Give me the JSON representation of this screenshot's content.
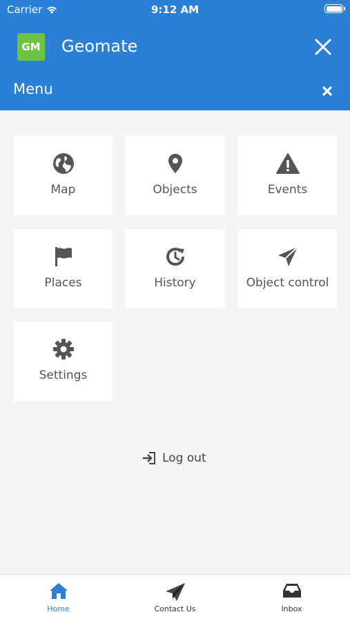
{
  "status_bar": {
    "carrier": "Carrier",
    "time": "9:12 AM"
  },
  "header": {
    "logo_text": "GM",
    "app_title": "Geomate",
    "menu_title": "Menu"
  },
  "menu_items": [
    {
      "label": "Map",
      "icon": "globe-icon"
    },
    {
      "label": "Objects",
      "icon": "map-pin-icon"
    },
    {
      "label": "Events",
      "icon": "warning-icon"
    },
    {
      "label": "Places",
      "icon": "flag-icon"
    },
    {
      "label": "History",
      "icon": "history-icon"
    },
    {
      "label": "Object control",
      "icon": "send-icon"
    },
    {
      "label": "Settings",
      "icon": "gear-icon"
    }
  ],
  "logout_label": "Log out",
  "tabs": [
    {
      "label": "Home",
      "icon": "home-icon",
      "active": true
    },
    {
      "label": "Contact Us",
      "icon": "paper-plane-icon",
      "active": false
    },
    {
      "label": "Inbox",
      "icon": "inbox-icon",
      "active": false
    }
  ],
  "colors": {
    "primary": "#2b7fd4",
    "logo_bg": "#6ec340",
    "icon": "#555555"
  }
}
